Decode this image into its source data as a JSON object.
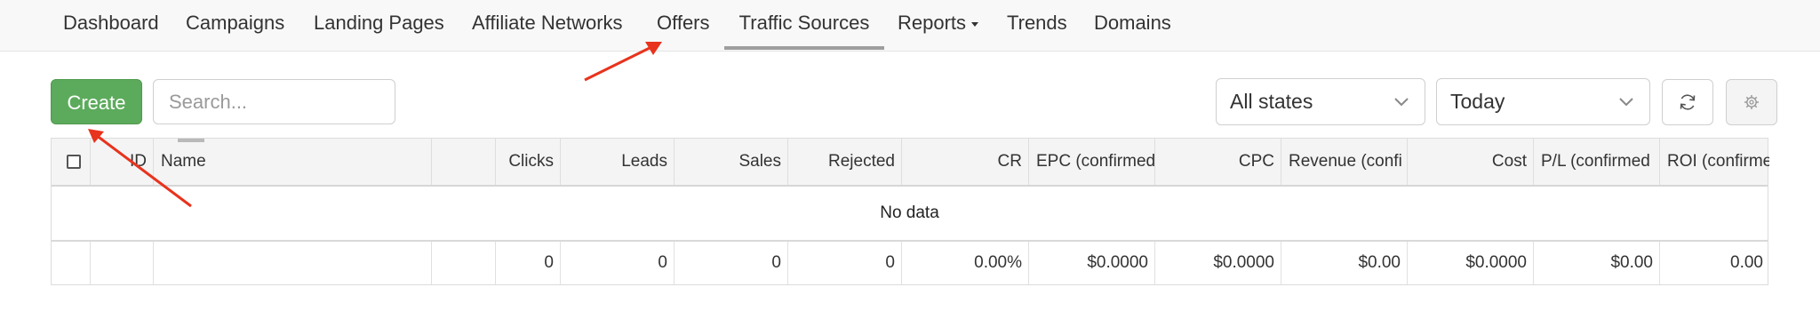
{
  "nav": {
    "items": [
      "Dashboard",
      "Campaigns",
      "Landing Pages",
      "Affiliate Networks",
      "Offers",
      "Traffic Sources",
      "Reports",
      "Trends",
      "Domains"
    ],
    "active": "Traffic Sources"
  },
  "toolbar": {
    "create_label": "Create",
    "search_placeholder": "Search...",
    "state_filter": "All states",
    "date_range": "Today",
    "refresh_icon": "refresh-icon",
    "settings_icon": "gear-icon"
  },
  "table": {
    "columns": [
      "ID",
      "Name",
      "Clicks",
      "Leads",
      "Sales",
      "Rejected",
      "CR",
      "EPC (confirmed",
      "CPC",
      "Revenue (confi",
      "Cost",
      "P/L (confirmed",
      "ROI (confirme"
    ],
    "empty_message": "No data",
    "totals": [
      "0",
      "0",
      "0",
      "0",
      "0.00%",
      "$0.0000",
      "$0.0000",
      "$0.00",
      "$0.0000",
      "$0.00",
      "0.00"
    ]
  },
  "annotation_color": "#e8331e"
}
